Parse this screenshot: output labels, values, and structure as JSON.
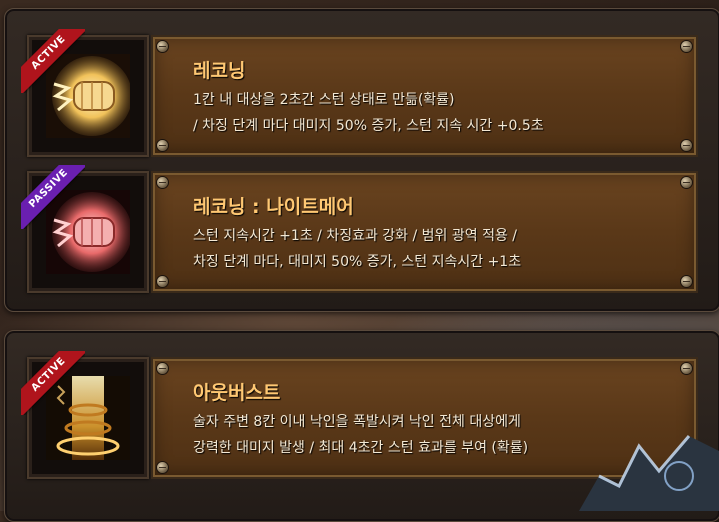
{
  "colors": {
    "active_badge": "#b0141c",
    "passive_badge": "#6a1fb0",
    "title": "#ffc873",
    "desc_text": "#f3e8d4",
    "panel": "#5a3818"
  },
  "skills": [
    {
      "badge": "ACTIVE",
      "icon": "fist-icon",
      "title": "레코닝",
      "desc_line1": "1칸 내 대상을 2초간 스턴 상태로 만듦(확률)",
      "desc_line2": "/ 차징 단계 마다 대미지 50% 증가, 스턴 지속 시간 +0.5초"
    },
    {
      "badge": "PASSIVE",
      "icon": "fist-icon",
      "title": "레코닝 : 나이트메어",
      "desc_line1": "스턴 지속시간 +1초 / 차징효과 강화 / 범위 광역 적용 /",
      "desc_line2": "차징 단계 마다, 대미지 50% 증가, 스턴 지속시간 +1초"
    },
    {
      "badge": "ACTIVE",
      "icon": "chain-burst-icon",
      "title": "아웃버스트",
      "desc_line1": "술자 주변 8칸 이내 낙인을 폭발시켜 낙인 전체 대상에게",
      "desc_line2": "강력한 대미지 발생 / 최대 4초간 스턴 효과를 부여 (확률)"
    }
  ]
}
